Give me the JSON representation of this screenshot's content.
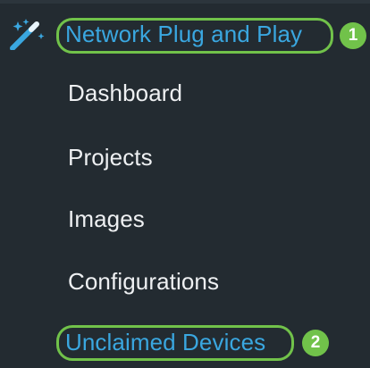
{
  "nav": {
    "section_title": "Network Plug and Play",
    "items": [
      {
        "label": "Dashboard"
      },
      {
        "label": "Projects"
      },
      {
        "label": "Images"
      },
      {
        "label": "Configurations"
      },
      {
        "label": "Unclaimed Devices"
      }
    ]
  },
  "annotations": {
    "step_1": "1",
    "step_2": "2"
  },
  "colors": {
    "background": "#232b31",
    "link_highlight": "#3aa7e0",
    "callout_green": "#71c24a",
    "menu_text": "#eef0f2"
  },
  "icons": {
    "section": "magic-wand-icon"
  }
}
